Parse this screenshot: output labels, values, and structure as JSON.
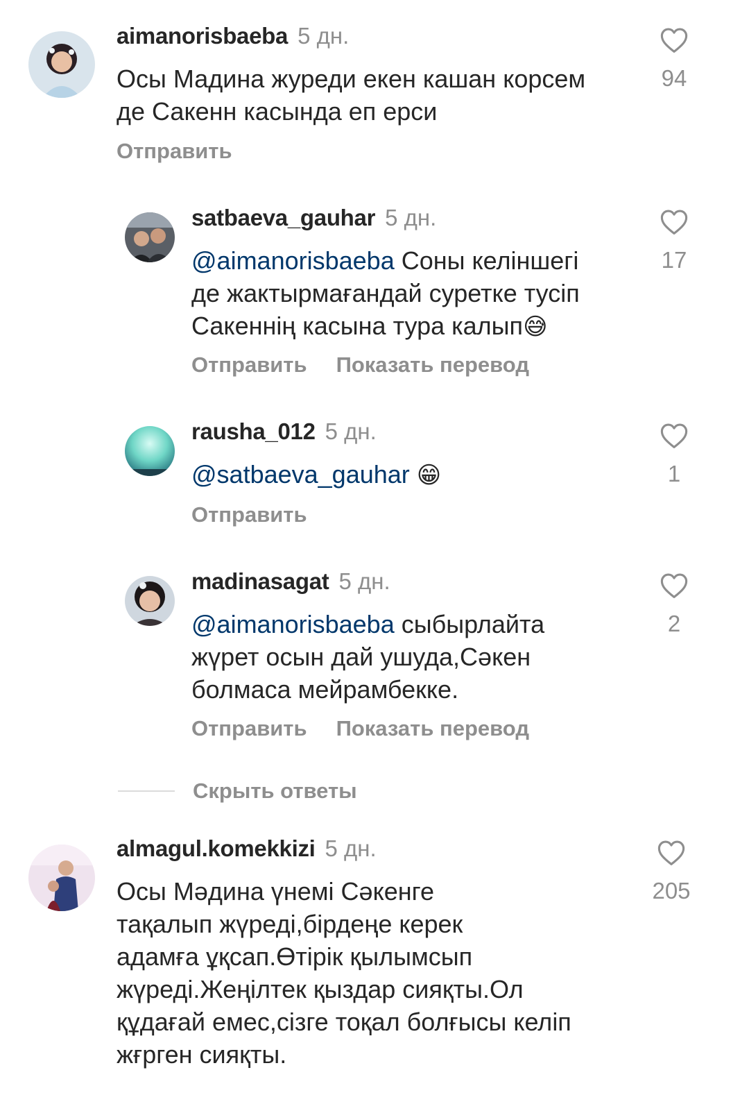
{
  "comments": [
    {
      "username": "aimanorisbaeba",
      "time": "5 дн.",
      "lines": [
        "Осы Мадина журеди екен кашан корсем",
        "де Сакенн касында еп ерси"
      ],
      "likes": "94",
      "actions": [
        "Отправить"
      ]
    },
    {
      "username": "satbaeva_gauhar",
      "time": "5 дн.",
      "mention": "@aimanorisbaeba",
      "line1_rest": " Соны келіншегі",
      "line2": "де жактырмағандай суретке тусіп",
      "line3": "Сакеннің касына тура калып",
      "emoji": "😅",
      "likes": "17",
      "actions": [
        "Отправить",
        "Показать перевод"
      ]
    },
    {
      "username": "rausha_012",
      "time": "5 дн.",
      "mention": "@satbaeva_gauhar",
      "emoji": "😁",
      "likes": "1",
      "actions": [
        "Отправить"
      ]
    },
    {
      "username": "madinasagat",
      "time": "5 дн.",
      "mention": "@aimanorisbaeba",
      "line1_rest": " сыбырлайта",
      "line2": "жүрет осын дай ушуда,Сәкен",
      "line3": "болмаса мейрамбекке.",
      "likes": "2",
      "actions": [
        "Отправить",
        "Показать перевод"
      ]
    },
    {
      "username": "almagul.komekkizi",
      "time": "5 дн.",
      "lines": [
        "Осы Мәдина үнемі Сәкенге",
        "тақалып жүреді,бірдеңе керек",
        "адамға ұқсап.Өтірік қылымсып",
        "жүреді.Жеңілтек қыздар сияқты.Ол",
        "құдағай емес,сізге тоқал болғысы келіп",
        "жғрген сияқты."
      ],
      "likes": "205"
    }
  ],
  "hide_replies": "Скрыть ответы",
  "colors": {
    "text": "#262626",
    "secondary": "#8e8e8e",
    "mention": "#00376b",
    "divider": "#dbdbdb"
  },
  "icons": {
    "like": "heart-outline-icon"
  }
}
